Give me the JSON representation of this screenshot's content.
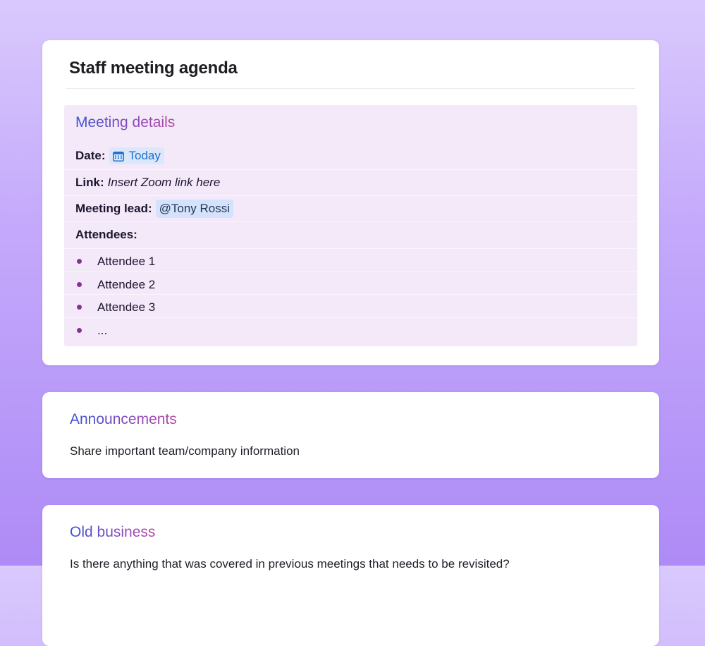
{
  "page": {
    "title": "Staff meeting agenda"
  },
  "meeting_details": {
    "heading": "Meeting details",
    "date_label": "Date:",
    "date_value": "Today",
    "link_label": "Link:",
    "link_value": "Insert Zoom link here",
    "lead_label": "Meeting lead:",
    "lead_value": "@Tony Rossi",
    "attendees_label": "Attendees:",
    "attendees": [
      "Attendee 1",
      "Attendee 2",
      "Attendee 3",
      "..."
    ]
  },
  "announcements": {
    "heading": "Announcements",
    "body": "Share important team/company information"
  },
  "old_business": {
    "heading": "Old business",
    "body": "Is there anything that was covered in previous meetings that needs to be revisited?"
  },
  "icons": {
    "date": "calendar-icon",
    "attendee_bullet": "bullet-dot"
  },
  "colors": {
    "heading_gradient_start": "#3a52d4",
    "heading_gradient_end": "#b0479f",
    "panel_bg": "#f3e9f8",
    "date_chip_bg": "#dbe7fb",
    "date_chip_text": "#1f6fce",
    "mention_bg": "#d4e3fb",
    "bullet": "#8b2f9a"
  }
}
